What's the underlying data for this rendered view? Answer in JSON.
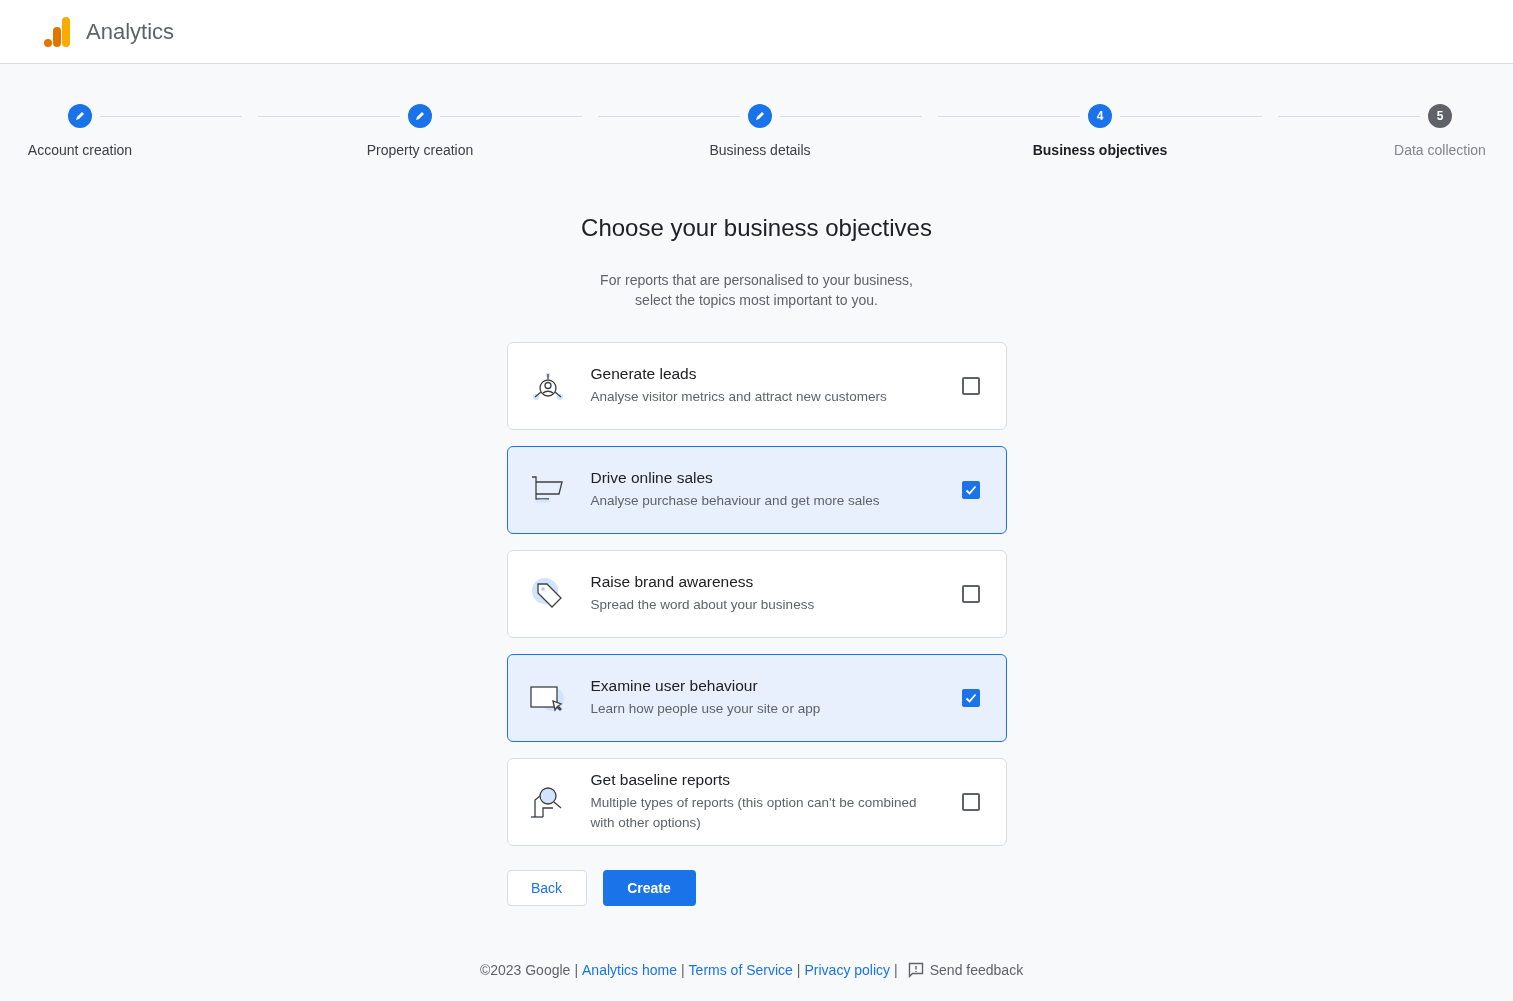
{
  "app": {
    "name": "Analytics"
  },
  "steps": [
    {
      "kind": "done",
      "label": "Account creation"
    },
    {
      "kind": "done",
      "label": "Property creation"
    },
    {
      "kind": "done",
      "label": "Business details"
    },
    {
      "kind": "current",
      "label": "Business objectives",
      "number": "4"
    },
    {
      "kind": "pending",
      "label": "Data collection",
      "number": "5"
    }
  ],
  "heading": "Choose your business objectives",
  "intro": [
    "For reports that are personalised to your business,",
    "select the topics most important to you."
  ],
  "objectives": [
    {
      "kind": "leads",
      "title": "Generate leads",
      "description": "Analyse visitor metrics and attract new customers",
      "checked": false
    },
    {
      "kind": "cart",
      "title": "Drive online sales",
      "description": "Analyse purchase behaviour and get more sales",
      "checked": true
    },
    {
      "kind": "tag",
      "title": "Raise brand awareness",
      "description": "Spread the word about your business",
      "checked": false
    },
    {
      "kind": "screen",
      "title": "Examine user behaviour",
      "description": "Learn how people use your site or app",
      "checked": true
    },
    {
      "kind": "report",
      "title": "Get baseline reports",
      "description": "Multiple types of reports (this option can't be combined with other options)",
      "checked": false
    }
  ],
  "buttons": {
    "back": "Back",
    "create": "Create"
  },
  "footer": {
    "items": [
      {
        "kind": "text",
        "label": "©2023 Google"
      },
      {
        "kind": "link",
        "label": "Analytics home"
      },
      {
        "kind": "link",
        "label": "Terms of Service"
      },
      {
        "kind": "link",
        "label": "Privacy policy"
      }
    ],
    "separator": "|",
    "feedback": "Send feedback"
  }
}
